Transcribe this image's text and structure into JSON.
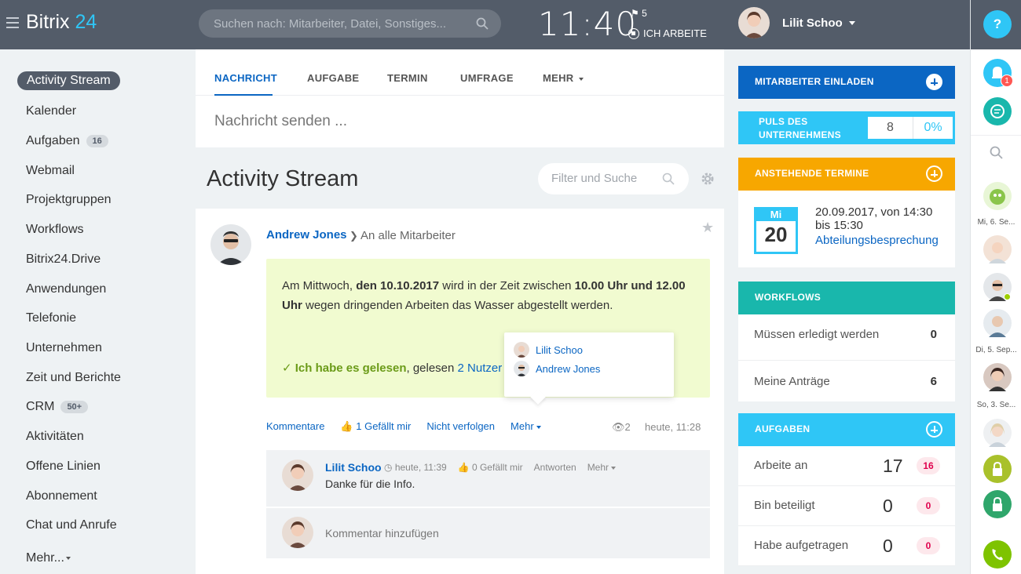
{
  "header": {
    "logo_main": "Bitrix",
    "logo_num": "24",
    "search_placeholder": "Suchen nach: Mitarbeiter, Datei, Sonstiges...",
    "time": "11:40",
    "flag_count": "5",
    "work_status": "ICH ARBEITE",
    "user_name": "Lilit Schoo"
  },
  "sidebar": {
    "items": [
      {
        "label": "Activity Stream"
      },
      {
        "label": "Kalender"
      },
      {
        "label": "Aufgaben",
        "count": "16"
      },
      {
        "label": "Webmail"
      },
      {
        "label": "Projektgruppen"
      },
      {
        "label": "Workflows"
      },
      {
        "label": "Bitrix24.Drive"
      },
      {
        "label": "Anwendungen"
      },
      {
        "label": "Telefonie"
      },
      {
        "label": "Unternehmen"
      },
      {
        "label": "Zeit und Berichte"
      },
      {
        "label": "CRM",
        "count": "50+"
      },
      {
        "label": "Aktivitäten"
      },
      {
        "label": "Offene Linien"
      },
      {
        "label": "Abonnement"
      },
      {
        "label": "Chat und Anrufe"
      },
      {
        "label": "Mehr..."
      }
    ]
  },
  "composer": {
    "tabs": [
      "NACHRICHT",
      "AUFGABE",
      "TERMIN",
      "UMFRAGE",
      "MEHR"
    ],
    "placeholder": "Nachricht senden ..."
  },
  "stream": {
    "title": "Activity Stream",
    "filter_placeholder": "Filter und Suche"
  },
  "post": {
    "author": "Andrew Jones",
    "recipient": "An alle Mitarbeiter",
    "text_1": "Am Mittwoch, ",
    "text_bold_1": "den 10.10.2017",
    "text_2": " wird in der Zeit zwischen ",
    "text_bold_2": "10.00 Uhr und 12.00 Uhr",
    "text_3": " wegen dringenden Arbeiten das Wasser abgestellt werden.",
    "read_confirm": "Ich habe es gelesen",
    "read_by": ", gelesen ",
    "read_link": "2 Nutzer",
    "popup_users": [
      "Lilit Schoo",
      "Andrew Jones"
    ],
    "actions": {
      "comments": "Kommentare",
      "like": "1 Gefällt mir",
      "unfollow": "Nicht verfolgen",
      "more": "Mehr"
    },
    "views": "2",
    "time": "heute, 11:28"
  },
  "comment": {
    "author": "Lilit Schoo",
    "time": "heute, 11:39",
    "likes": "0 Gefällt mir",
    "reply": "Antworten",
    "more": "Mehr",
    "text": "Danke für die Info.",
    "add_placeholder": "Kommentar hinzufügen"
  },
  "right_panel": {
    "invite": "MITARBEITER EINLADEN",
    "pulse_label": "PULS DES UNTERNEHMENS",
    "pulse_value": "8",
    "pulse_percent": "0%",
    "events_title": "ANSTEHENDE TERMINE",
    "event_day": "Mi",
    "event_date": "20",
    "event_time_1": "20.09.2017, von 14:30",
    "event_time_2": "bis 15:30",
    "event_name": "Abteilungsbesprechung",
    "workflows_title": "WORKFLOWS",
    "workflow_rows": [
      {
        "label": "Müssen erledigt werden",
        "value": "0"
      },
      {
        "label": "Meine Anträge",
        "value": "6"
      }
    ],
    "tasks_title": "AUFGABEN",
    "task_rows": [
      {
        "label": "Arbeite an",
        "value": "17",
        "badge": "16"
      },
      {
        "label": "Bin beteiligt",
        "value": "0",
        "badge": "0"
      },
      {
        "label": "Habe aufgetragen",
        "value": "0",
        "badge": "0"
      }
    ]
  },
  "right_bar": {
    "help": "?",
    "notif_count": "1",
    "dates": [
      "Mi, 6. Se...",
      "Di, 5. Sep...",
      "So, 3. Se..."
    ]
  },
  "colors": {
    "topbar": "#535c69",
    "accent_blue": "#0b66c3",
    "cyan": "#2fc6f6",
    "orange": "#f7a700",
    "teal": "#19b7ac",
    "notice_bg": "#f1fbd0"
  }
}
